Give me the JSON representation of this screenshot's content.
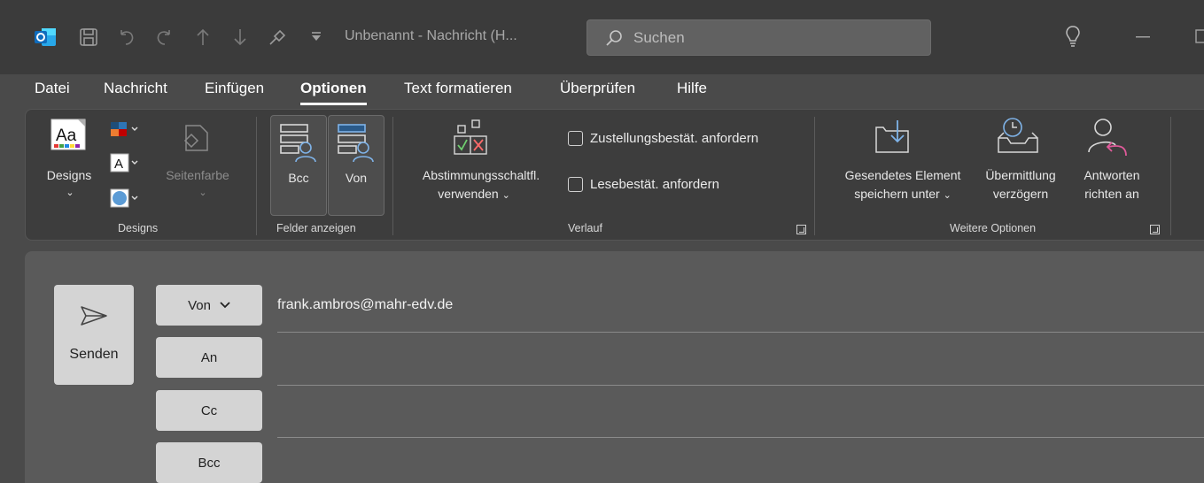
{
  "window": {
    "title": "Unbenannt - Nachricht (H...",
    "search_placeholder": "Suchen"
  },
  "tabs": [
    {
      "label": "Datei",
      "active": false
    },
    {
      "label": "Nachricht",
      "active": false
    },
    {
      "label": "Einfügen",
      "active": false
    },
    {
      "label": "Optionen",
      "active": true
    },
    {
      "label": "Text formatieren",
      "active": false
    },
    {
      "label": "Überprüfen",
      "active": false
    },
    {
      "label": "Hilfe",
      "active": false
    }
  ],
  "ribbon": {
    "designs": {
      "designs_label": "Designs",
      "seitenfarbe_label": "Seitenfarbe",
      "group_label": "Designs"
    },
    "felder": {
      "bcc_label": "Bcc",
      "von_label": "Von",
      "group_label": "Felder anzeigen"
    },
    "verlauf": {
      "abstimmung_line1": "Abstimmungsschaltfl.",
      "abstimmung_line2": "verwenden",
      "zustellung_label": "Zustellungsbestät. anfordern",
      "lese_label": "Lesebestät. anfordern",
      "group_label": "Verlauf"
    },
    "weitere": {
      "gesendet_line1": "Gesendetes Element",
      "gesendet_line2": "speichern unter",
      "uebermittlung_line1": "Übermittlung",
      "uebermittlung_line2": "verzögern",
      "antworten_line1": "Antworten",
      "antworten_line2": "richten an",
      "group_label": "Weitere Optionen"
    }
  },
  "compose": {
    "send_label": "Senden",
    "from_button": "Von",
    "to_button": "An",
    "cc_button": "Cc",
    "bcc_button": "Bcc",
    "from_value": "frank.ambros@mahr-edv.de"
  },
  "colors": {
    "titlebar_bg": "#3b3b3b",
    "ribbon_bg": "#3d3d3d",
    "compose_bg": "#5a5a5a",
    "outlook_blue": "#0f6cbd"
  }
}
